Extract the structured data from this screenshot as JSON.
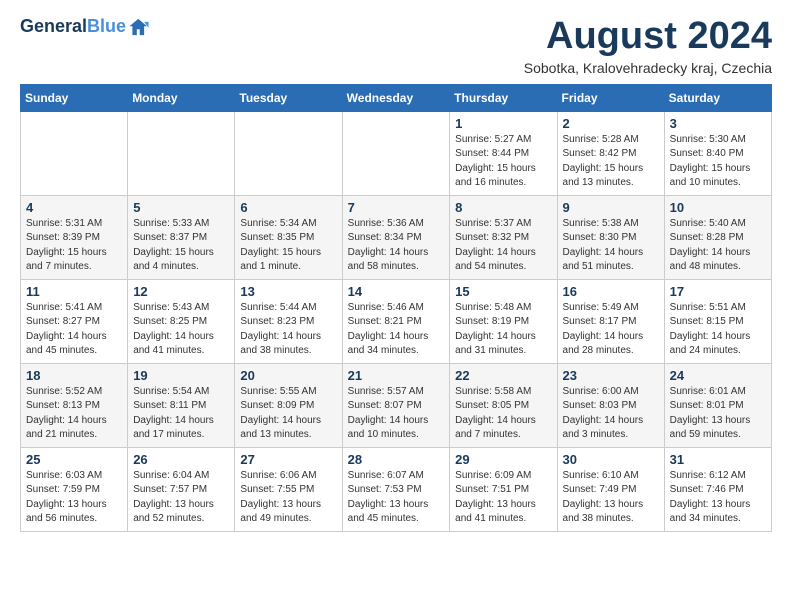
{
  "logo": {
    "line1": "General",
    "line2": "Blue"
  },
  "title": "August 2024",
  "subtitle": "Sobotka, Kralovehradecky kraj, Czechia",
  "weekdays": [
    "Sunday",
    "Monday",
    "Tuesday",
    "Wednesday",
    "Thursday",
    "Friday",
    "Saturday"
  ],
  "weeks": [
    [
      {
        "day": "",
        "info": ""
      },
      {
        "day": "",
        "info": ""
      },
      {
        "day": "",
        "info": ""
      },
      {
        "day": "",
        "info": ""
      },
      {
        "day": "1",
        "info": "Sunrise: 5:27 AM\nSunset: 8:44 PM\nDaylight: 15 hours\nand 16 minutes."
      },
      {
        "day": "2",
        "info": "Sunrise: 5:28 AM\nSunset: 8:42 PM\nDaylight: 15 hours\nand 13 minutes."
      },
      {
        "day": "3",
        "info": "Sunrise: 5:30 AM\nSunset: 8:40 PM\nDaylight: 15 hours\nand 10 minutes."
      }
    ],
    [
      {
        "day": "4",
        "info": "Sunrise: 5:31 AM\nSunset: 8:39 PM\nDaylight: 15 hours\nand 7 minutes."
      },
      {
        "day": "5",
        "info": "Sunrise: 5:33 AM\nSunset: 8:37 PM\nDaylight: 15 hours\nand 4 minutes."
      },
      {
        "day": "6",
        "info": "Sunrise: 5:34 AM\nSunset: 8:35 PM\nDaylight: 15 hours\nand 1 minute."
      },
      {
        "day": "7",
        "info": "Sunrise: 5:36 AM\nSunset: 8:34 PM\nDaylight: 14 hours\nand 58 minutes."
      },
      {
        "day": "8",
        "info": "Sunrise: 5:37 AM\nSunset: 8:32 PM\nDaylight: 14 hours\nand 54 minutes."
      },
      {
        "day": "9",
        "info": "Sunrise: 5:38 AM\nSunset: 8:30 PM\nDaylight: 14 hours\nand 51 minutes."
      },
      {
        "day": "10",
        "info": "Sunrise: 5:40 AM\nSunset: 8:28 PM\nDaylight: 14 hours\nand 48 minutes."
      }
    ],
    [
      {
        "day": "11",
        "info": "Sunrise: 5:41 AM\nSunset: 8:27 PM\nDaylight: 14 hours\nand 45 minutes."
      },
      {
        "day": "12",
        "info": "Sunrise: 5:43 AM\nSunset: 8:25 PM\nDaylight: 14 hours\nand 41 minutes."
      },
      {
        "day": "13",
        "info": "Sunrise: 5:44 AM\nSunset: 8:23 PM\nDaylight: 14 hours\nand 38 minutes."
      },
      {
        "day": "14",
        "info": "Sunrise: 5:46 AM\nSunset: 8:21 PM\nDaylight: 14 hours\nand 34 minutes."
      },
      {
        "day": "15",
        "info": "Sunrise: 5:48 AM\nSunset: 8:19 PM\nDaylight: 14 hours\nand 31 minutes."
      },
      {
        "day": "16",
        "info": "Sunrise: 5:49 AM\nSunset: 8:17 PM\nDaylight: 14 hours\nand 28 minutes."
      },
      {
        "day": "17",
        "info": "Sunrise: 5:51 AM\nSunset: 8:15 PM\nDaylight: 14 hours\nand 24 minutes."
      }
    ],
    [
      {
        "day": "18",
        "info": "Sunrise: 5:52 AM\nSunset: 8:13 PM\nDaylight: 14 hours\nand 21 minutes."
      },
      {
        "day": "19",
        "info": "Sunrise: 5:54 AM\nSunset: 8:11 PM\nDaylight: 14 hours\nand 17 minutes."
      },
      {
        "day": "20",
        "info": "Sunrise: 5:55 AM\nSunset: 8:09 PM\nDaylight: 14 hours\nand 13 minutes."
      },
      {
        "day": "21",
        "info": "Sunrise: 5:57 AM\nSunset: 8:07 PM\nDaylight: 14 hours\nand 10 minutes."
      },
      {
        "day": "22",
        "info": "Sunrise: 5:58 AM\nSunset: 8:05 PM\nDaylight: 14 hours\nand 7 minutes."
      },
      {
        "day": "23",
        "info": "Sunrise: 6:00 AM\nSunset: 8:03 PM\nDaylight: 14 hours\nand 3 minutes."
      },
      {
        "day": "24",
        "info": "Sunrise: 6:01 AM\nSunset: 8:01 PM\nDaylight: 13 hours\nand 59 minutes."
      }
    ],
    [
      {
        "day": "25",
        "info": "Sunrise: 6:03 AM\nSunset: 7:59 PM\nDaylight: 13 hours\nand 56 minutes."
      },
      {
        "day": "26",
        "info": "Sunrise: 6:04 AM\nSunset: 7:57 PM\nDaylight: 13 hours\nand 52 minutes."
      },
      {
        "day": "27",
        "info": "Sunrise: 6:06 AM\nSunset: 7:55 PM\nDaylight: 13 hours\nand 49 minutes."
      },
      {
        "day": "28",
        "info": "Sunrise: 6:07 AM\nSunset: 7:53 PM\nDaylight: 13 hours\nand 45 minutes."
      },
      {
        "day": "29",
        "info": "Sunrise: 6:09 AM\nSunset: 7:51 PM\nDaylight: 13 hours\nand 41 minutes."
      },
      {
        "day": "30",
        "info": "Sunrise: 6:10 AM\nSunset: 7:49 PM\nDaylight: 13 hours\nand 38 minutes."
      },
      {
        "day": "31",
        "info": "Sunrise: 6:12 AM\nSunset: 7:46 PM\nDaylight: 13 hours\nand 34 minutes."
      }
    ]
  ]
}
